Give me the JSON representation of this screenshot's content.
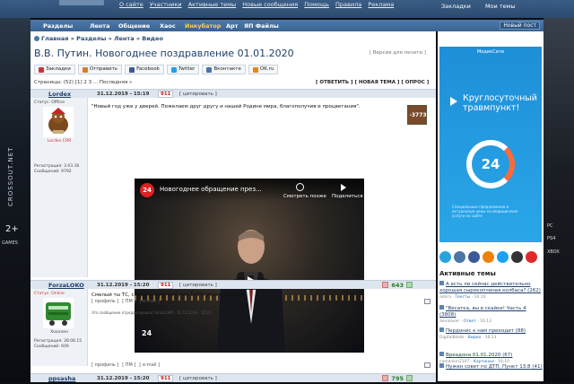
{
  "topbar": {
    "links": [
      "О сайте",
      "Участники",
      "Активные темы",
      "Новые сообщения",
      "Помощь",
      "Правила",
      "Реклама"
    ],
    "bookmarks": "Закладки",
    "my_topics": "Мои темы"
  },
  "nav": {
    "items": [
      "Разделы",
      "Лента",
      "Общение",
      "Хаос",
      "Инкубатор",
      "Арт",
      "ЯП Файлы"
    ],
    "new_post": "Новый пост"
  },
  "breadcrumb": "Главная » Разделы » Лента » Видео",
  "page_title": "В.В. Путин. Новогоднее поздравление 01.01.2020",
  "print_version": "[ Версия для печати ]",
  "share": [
    "Закладки",
    "Отправить",
    "Facebook",
    "Twitter",
    "Вконтакте",
    "OK.ru"
  ],
  "pagination": "Страницы: (52) [1] 2 3 ... Последняя »",
  "actions": "[ ОТВЕТИТЬ ] [ НОВАЯ ТЕМА ] [ ОПРОС ]",
  "posts": [
    {
      "author": "Lordex",
      "date": "31.12.2019 - 15:19",
      "num": "911",
      "quote": "[ цитировать ]",
      "status": "Статус: Offline",
      "avname": "Lordex СЯЯ",
      "meta": "Регистрация: 3.03.16\nСообщений: 9792",
      "text": "\"Новый год уже у дверей. Пожелаем друг другу и нашей Родине мира, благополучия и процветания\".",
      "rep": "-3773",
      "foot": [
        "[ профиль ]",
        "[ ПМ ]",
        "[ e-mail ]"
      ]
    },
    {
      "author": "ForzaLOKO",
      "date": "31.12.2019 - 15:20",
      "num": "911",
      "quote": "[ цитировать ]",
      "status": "Статус: Online",
      "avname": "Хохолен",
      "meta": "Регистрация: 28.06.15\nСообщений: 609",
      "text": "Смелый ты ТС, создать тему которая 146% уйдет к мухам",
      "edit": "Это сообщение отредактировал ForzaLOKO - 31.12.2019 - 15:21",
      "rep": "643",
      "foot": [
        "[ профиль ]",
        "[ ПМ ]",
        "[ e-mail ]"
      ]
    },
    {
      "author": "ppsasha",
      "date": "31.12.2019 - 15:20",
      "num": "911",
      "quote": "[ цитировать ]",
      "rep": "795"
    }
  ],
  "video": {
    "channel": "24",
    "title": "Новогоднее обращение през...",
    "watch_later": "Смотреть позже",
    "share": "Поделиться"
  },
  "ad": {
    "brand": "МедикСити",
    "headline": "Круглосуточный травмпункт!",
    "number": "24",
    "fine": "Специальные предложения и актуальные цены на медицинские услуги на сайте"
  },
  "active_topics": {
    "heading": "Активные темы",
    "items": [
      {
        "title": "А есть ли сейчас действительно хорошая сырокопченая колбаса?",
        "count": "(262)",
        "user": "adora",
        "section": "Тексты",
        "time": "16:10"
      },
      {
        "title": "\"Весатка, вы в скайке! Часть 4",
        "count": "(3808)",
        "user": "aevalaver",
        "section": "Ответ",
        "time": "16:13"
      },
      {
        "title": "Пердонис к нам приходит",
        "count": "(88)",
        "user": "DigitalBlade",
        "section": "Видео",
        "time": "16:13"
      },
      {
        "title": "Вреадона 01.01.2020",
        "count": "(67)",
        "user": "camenkin2107",
        "section": "Картинки",
        "time": "16:10"
      },
      {
        "title": "Нужен совет по ДТП, Пункт 13.8",
        "count": "(41)",
        "user": "",
        "section": "",
        "time": ""
      }
    ]
  },
  "left_brand": [
    "CROSSOUT.NET",
    "2+",
    "GAMES"
  ],
  "right_platforms": [
    "PC",
    "PS4",
    "XBOX"
  ]
}
